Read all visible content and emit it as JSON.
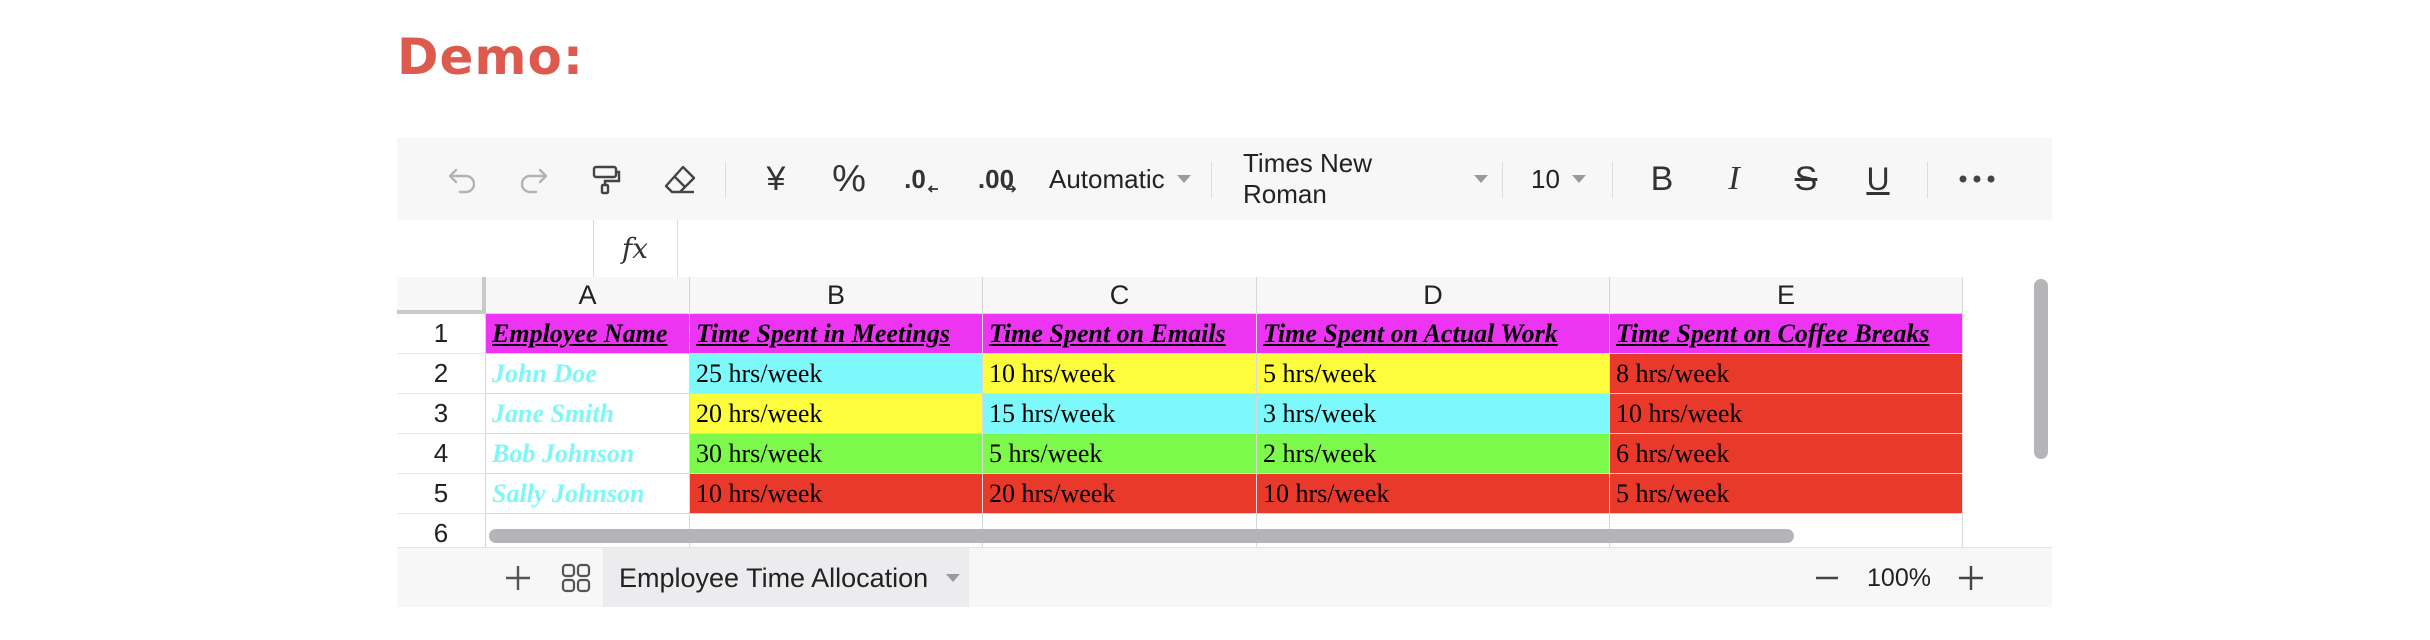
{
  "page_title": "Demo:",
  "toolbar": {
    "undo_icon": "undo-icon",
    "redo_icon": "redo-icon",
    "format_painter_icon": "format-painter-icon",
    "clear_format_icon": "eraser-icon",
    "currency_symbol": "¥",
    "percent_symbol": "%",
    "decrease_decimal_label": ".0",
    "increase_decimal_label": ".00",
    "number_format": "Automatic",
    "font_family": "Times New Roman",
    "font_size": "10",
    "bold_label": "B",
    "italic_label": "I",
    "strike_label": "S",
    "underline_label": "U",
    "more_icon": "more-icon"
  },
  "formula_bar": {
    "fx_label": "fx",
    "cell_ref": "",
    "formula": ""
  },
  "sheet": {
    "columns": [
      "A",
      "B",
      "C",
      "D",
      "E"
    ],
    "rows": [
      "1",
      "2",
      "3",
      "4",
      "5",
      "6"
    ],
    "header_row": [
      "Employee Name",
      "Time Spent in Meetings",
      "Time Spent on Emails",
      "Time Spent on Actual Work",
      "Time Spent on Coffee Breaks"
    ],
    "data_rows": [
      [
        "John Doe",
        "25 hrs/week",
        "10 hrs/week",
        "5 hrs/week",
        "8 hrs/week"
      ],
      [
        "Jane Smith",
        "20 hrs/week",
        "15 hrs/week",
        "3 hrs/week",
        "10 hrs/week"
      ],
      [
        "Bob Johnson",
        "30 hrs/week",
        "5 hrs/week",
        "2 hrs/week",
        "6 hrs/week"
      ],
      [
        "Sally Johnson",
        "10 hrs/week",
        "20 hrs/week",
        "10 hrs/week",
        "5 hrs/week"
      ]
    ],
    "header_fill": "#ec34f2",
    "name_text_color": "#7df7f7",
    "cell_fills": [
      [
        "#ffffff",
        "#7df9fb",
        "#fdfd3e",
        "#fdfd3e",
        "#e8392a"
      ],
      [
        "#ffffff",
        "#fdfd3e",
        "#7df9fb",
        "#7df9fb",
        "#e8392a"
      ],
      [
        "#ffffff",
        "#7cf94a",
        "#7cf94a",
        "#7cf94a",
        "#e8392a"
      ],
      [
        "#ffffff",
        "#e8392a",
        "#e8392a",
        "#e8392a",
        "#e8392a"
      ]
    ]
  },
  "bottom_bar": {
    "add_sheet_icon": "plus-icon",
    "sheet_list_icon": "grid-icon",
    "active_sheet": "Employee Time Allocation",
    "zoom_out_icon": "minus-icon",
    "zoom_level": "100%",
    "zoom_in_icon": "plus-icon"
  },
  "colors": {
    "title": "#dd5a4f",
    "toolbar_bg": "#f7f7f8"
  }
}
